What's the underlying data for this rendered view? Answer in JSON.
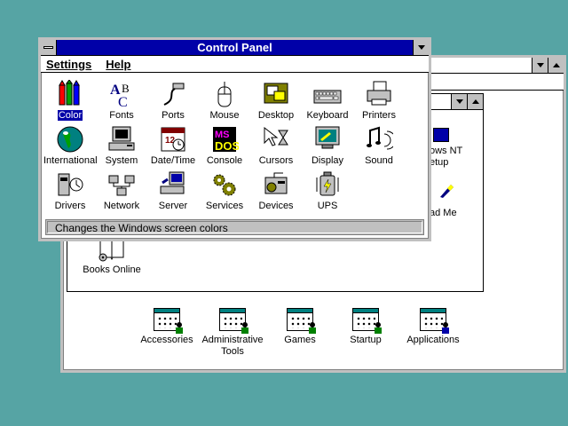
{
  "program_manager": {
    "groups": [
      {
        "label": "Accessories"
      },
      {
        "label": "Administrative Tools"
      },
      {
        "label": "Games"
      },
      {
        "label": "Startup"
      },
      {
        "label": "Applications"
      }
    ]
  },
  "main_group": {
    "partial_labels": [
      "ows NT",
      "etup",
      "ad Me"
    ],
    "books_online": "Books Online"
  },
  "control_panel": {
    "title": "Control Panel",
    "menu": [
      "Settings",
      "Help"
    ],
    "icons": [
      {
        "label": "Color",
        "icon": "color-icon",
        "selected": true
      },
      {
        "label": "Fonts",
        "icon": "fonts-icon"
      },
      {
        "label": "Ports",
        "icon": "ports-icon"
      },
      {
        "label": "Mouse",
        "icon": "mouse-icon"
      },
      {
        "label": "Desktop",
        "icon": "desktop-icon"
      },
      {
        "label": "Keyboard",
        "icon": "keyboard-icon"
      },
      {
        "label": "Printers",
        "icon": "printers-icon"
      },
      {
        "label": "International",
        "icon": "globe-icon"
      },
      {
        "label": "System",
        "icon": "system-icon"
      },
      {
        "label": "Date/Time",
        "icon": "calendar-icon"
      },
      {
        "label": "Console",
        "icon": "console-icon"
      },
      {
        "label": "Cursors",
        "icon": "cursors-icon"
      },
      {
        "label": "Display",
        "icon": "display-icon"
      },
      {
        "label": "Sound",
        "icon": "sound-icon"
      },
      {
        "label": "Drivers",
        "icon": "drivers-icon"
      },
      {
        "label": "Network",
        "icon": "network-icon"
      },
      {
        "label": "Server",
        "icon": "server-icon"
      },
      {
        "label": "Services",
        "icon": "services-icon"
      },
      {
        "label": "Devices",
        "icon": "devices-icon"
      },
      {
        "label": "UPS",
        "icon": "ups-icon"
      }
    ],
    "status": "Changes the Windows screen colors"
  },
  "colors": {
    "desktop": "#56a4a4",
    "active_title": "#0000a8",
    "face": "#c0c0c0"
  }
}
